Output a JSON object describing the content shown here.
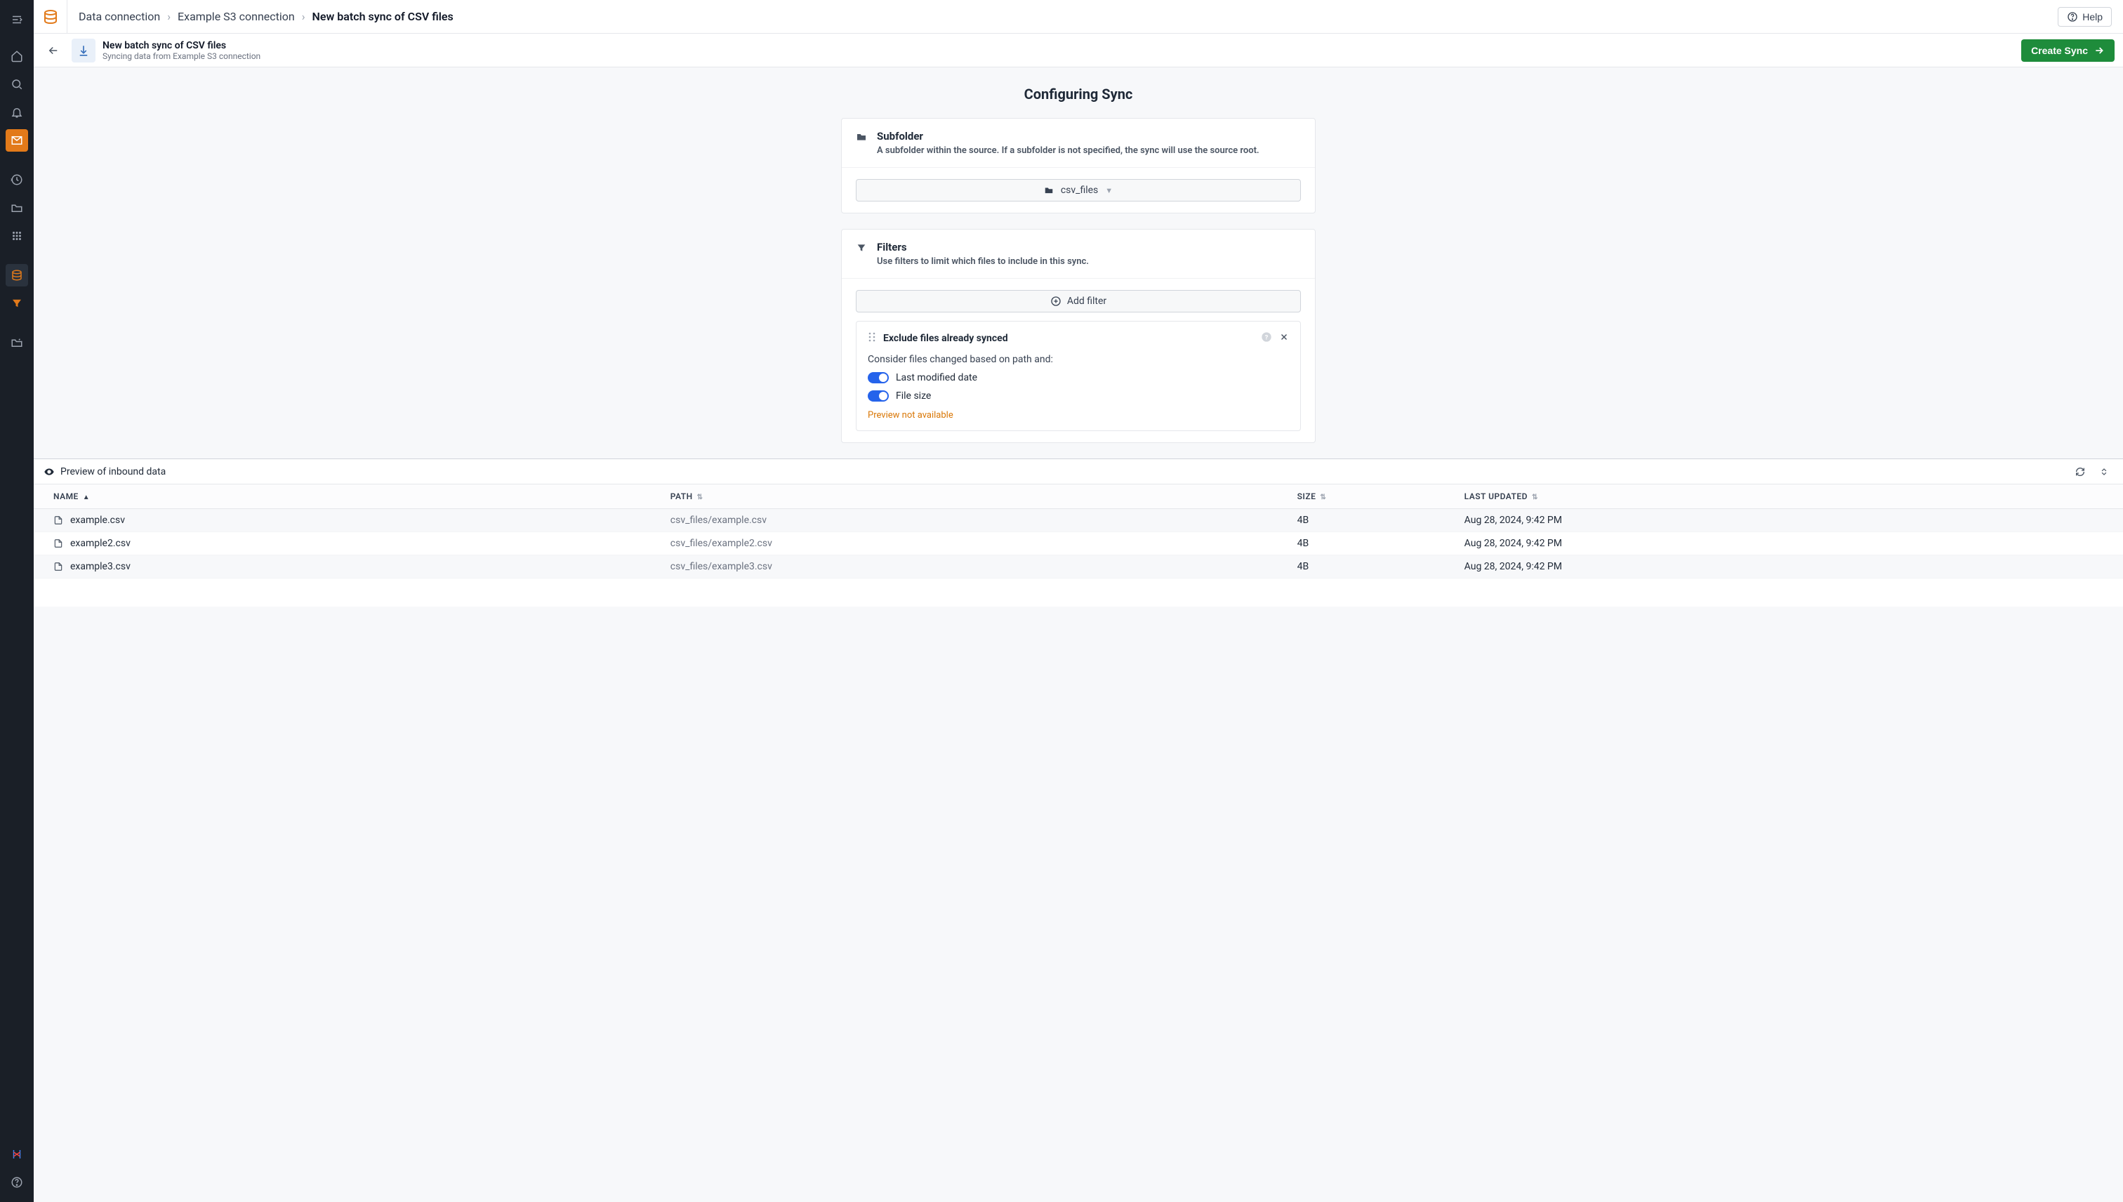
{
  "breadcrumb": {
    "items": [
      "Data connection",
      "Example S3 connection",
      "New batch sync of CSV files"
    ]
  },
  "help_label": "Help",
  "header": {
    "title": "New batch sync of CSV files",
    "subtitle": "Syncing data from Example S3 connection",
    "create_label": "Create Sync"
  },
  "page_title": "Configuring Sync",
  "subfolder": {
    "title": "Subfolder",
    "desc": "A subfolder within the source. If a subfolder is not specified, the sync will use the source root.",
    "value": "csv_files"
  },
  "filters": {
    "title": "Filters",
    "desc": "Use filters to limit which files to include in this sync.",
    "add_label": "Add filter",
    "exclude": {
      "title": "Exclude files already synced",
      "consider_line": "Consider files changed based on path and:",
      "opt_last_modified": "Last modified date",
      "opt_file_size": "File size",
      "preview_warn": "Preview not available"
    }
  },
  "preview": {
    "title": "Preview of inbound data",
    "columns": {
      "name": "NAME",
      "path": "PATH",
      "size": "SIZE",
      "updated": "LAST UPDATED"
    },
    "rows": [
      {
        "name": "example.csv",
        "path": "csv_files/example.csv",
        "size": "4B",
        "updated": "Aug 28, 2024, 9:42 PM"
      },
      {
        "name": "example2.csv",
        "path": "csv_files/example2.csv",
        "size": "4B",
        "updated": "Aug 28, 2024, 9:42 PM"
      },
      {
        "name": "example3.csv",
        "path": "csv_files/example3.csv",
        "size": "4B",
        "updated": "Aug 28, 2024, 9:42 PM"
      }
    ]
  }
}
